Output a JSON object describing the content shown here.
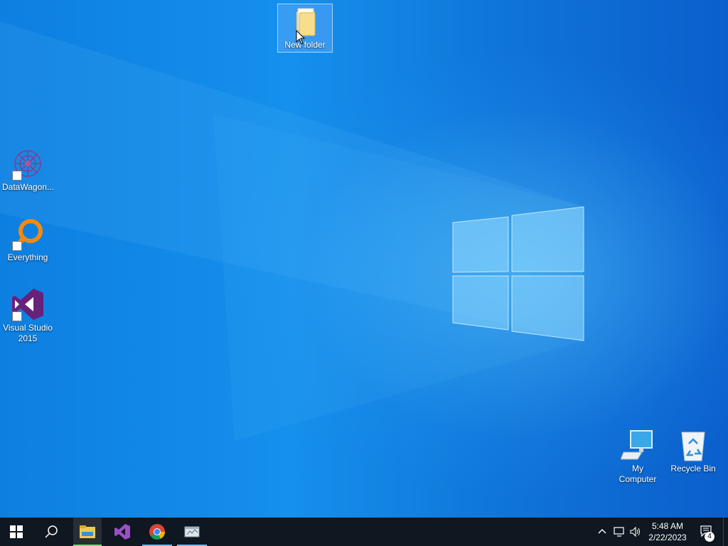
{
  "desktop": {
    "icons": [
      {
        "label": "New folder",
        "icon": "folder-icon"
      },
      {
        "label": "DataWagon...",
        "icon": "datawagon-icon"
      },
      {
        "label": "Everything",
        "icon": "everything-search-icon"
      },
      {
        "label": "Visual Studio\n2015",
        "icon": "visual-studio-icon"
      },
      {
        "label": "My Computer",
        "icon": "computer-icon"
      },
      {
        "label": "Recycle Bin",
        "icon": "recycle-bin-icon"
      }
    ]
  },
  "taskbar": {
    "buttons": [
      {
        "name": "start",
        "icon": "windows-logo-icon"
      },
      {
        "name": "search",
        "icon": "search-icon"
      },
      {
        "name": "file-explorer",
        "icon": "folder-icon",
        "active": true
      },
      {
        "name": "visual-studio",
        "icon": "visual-studio-icon"
      },
      {
        "name": "chrome",
        "icon": "chrome-icon"
      },
      {
        "name": "app-window",
        "icon": "window-app-icon"
      }
    ],
    "tray": {
      "time": "5:48 AM",
      "date": "2/22/2023",
      "notification_count": "4"
    }
  },
  "colors": {
    "desktop_bg": "#0a63d6",
    "taskbar_bg": "#0f1720",
    "accent": "#76b9ed"
  }
}
